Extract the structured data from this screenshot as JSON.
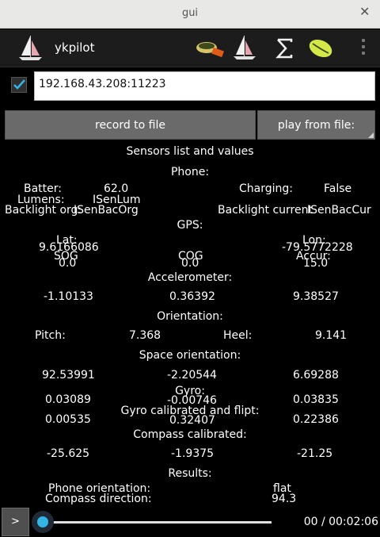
{
  "window": {
    "title": "gui",
    "close_glyph": "✕"
  },
  "actionbar": {
    "app_name": "ykpilot",
    "icons": [
      "sailboat-logo-icon",
      "magnifier-icon",
      "sailboat-icon",
      "sigma-icon",
      "rugby-ball-icon",
      "overflow-menu-icon"
    ]
  },
  "connection": {
    "enabled": true,
    "address": "192.168.43.208:11223"
  },
  "buttons": {
    "record": "record to file",
    "play": "play from file:"
  },
  "sensors": {
    "header": "Sensors list and values",
    "phone": {
      "title": "Phone:",
      "batter_label": "Batter:",
      "batter_value": "62.0",
      "charging_label": "Charging:",
      "charging_value": "False",
      "lumens_label": "Lumens:",
      "lumens_value": "ISenLum",
      "backlight_org_label": "Backlight org:",
      "backlight_org_value": "ISenBacOrg",
      "backlight_current_label": "Backlight current",
      "backlight_current_value": "ISenBacCur"
    },
    "gps": {
      "title": "GPS:",
      "lat_label": "Lat:",
      "lat_value": "9.6166086",
      "lon_label": "Lon:",
      "lon_value": "-79.5772228",
      "sog_label": "SOG",
      "sog_value": "0.0",
      "cog_label": "COG",
      "cog_value": "0.0",
      "accur_label": "Accur:",
      "accur_value": "15.0"
    },
    "accelerometer": {
      "title": "Accelerometer:",
      "values": [
        "-1.10133",
        "0.36392",
        "9.38527"
      ]
    },
    "orientation": {
      "title": "Orientation:",
      "pitch_label": "Pitch:",
      "pitch_value": "7.368",
      "heel_label": "Heel:",
      "heel_value": "9.141"
    },
    "space_orientation": {
      "title": "Space orientation:",
      "values": [
        "92.53991",
        "-2.20544",
        "6.69288"
      ]
    },
    "gyro": {
      "title": "Gyro:",
      "values": [
        "0.03089",
        "-0.00746",
        "0.03835"
      ]
    },
    "gyro_calibrated": {
      "title": "Gyro calibrated and flipt:",
      "values": [
        "0.00535",
        "0.32407",
        "0.22386"
      ]
    },
    "compass_calibrated": {
      "title": "Compass calibrated:",
      "values": [
        "-25.625",
        "-1.9375",
        "-21.25"
      ]
    },
    "results": {
      "title": "Results:",
      "phone_orientation_label": "Phone orientation:",
      "phone_orientation_value": "flat",
      "compass_direction_label": "Compass direction:",
      "compass_direction_value": "94.3"
    }
  },
  "player": {
    "play_label": ">",
    "progress": 0.0,
    "time": "00 / 00:02:06"
  },
  "colors": {
    "accent": "#33b5e5",
    "background": "#000000",
    "button": "#6a6a6a"
  }
}
